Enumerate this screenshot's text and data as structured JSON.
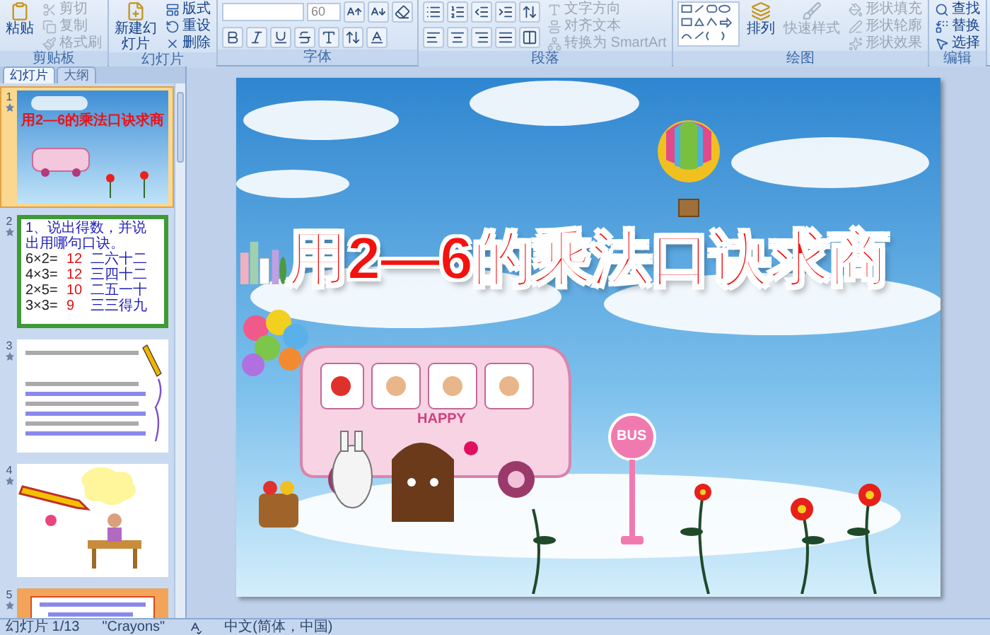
{
  "ribbon": {
    "groups": [
      {
        "kind": "clipboard",
        "label": "剪贴板",
        "large": [
          {
            "label": "粘贴",
            "disabled": false
          }
        ],
        "items": [
          {
            "label": "剪切",
            "disabled": true
          },
          {
            "label": "复制",
            "disabled": true
          },
          {
            "label": "格式刷",
            "disabled": true
          }
        ]
      },
      {
        "kind": "slides",
        "label": "幻灯片",
        "large": [
          {
            "label": "新建幻灯片",
            "disabled": false
          }
        ],
        "items": [
          {
            "label": "版式",
            "disabled": false
          },
          {
            "label": "重设",
            "disabled": false
          },
          {
            "label": "删除",
            "disabled": false
          }
        ]
      },
      {
        "kind": "font",
        "label": "字体",
        "size": "60"
      },
      {
        "kind": "paragraph",
        "label": "段落",
        "items": [
          {
            "label": "文字方向",
            "disabled": true
          },
          {
            "label": "对齐文本",
            "disabled": true
          },
          {
            "label": "转换为 SmartArt",
            "disabled": true
          }
        ]
      },
      {
        "kind": "drawing",
        "label": "绘图",
        "large": [
          {
            "label": "排列",
            "disabled": false
          },
          {
            "label": "快速样式",
            "disabled": true
          }
        ],
        "items": [
          {
            "label": "形状填充",
            "disabled": true
          },
          {
            "label": "形状轮廓",
            "disabled": true
          },
          {
            "label": "形状效果",
            "disabled": true
          }
        ]
      },
      {
        "kind": "editing",
        "label": "编辑",
        "items": [
          {
            "label": "查找",
            "disabled": false
          },
          {
            "label": "替换",
            "disabled": false
          },
          {
            "label": "选择",
            "disabled": false
          }
        ]
      }
    ]
  },
  "panel": {
    "tabs": [
      {
        "label": "幻灯片",
        "selected": true
      },
      {
        "label": "大纲",
        "selected": false
      }
    ],
    "slides": [
      {
        "number": "1",
        "selected": true,
        "kind": "title",
        "title": "用2—6的乘法口诀求商"
      },
      {
        "number": "2",
        "selected": false,
        "kind": "exercise",
        "heading": "1、说出得数，并说出用哪句口诀。",
        "rows": [
          {
            "expr": "6×2=",
            "answer": "12",
            "rhyme": "二六十二"
          },
          {
            "expr": "4×3=",
            "answer": "12",
            "rhyme": "三四十二"
          },
          {
            "expr": "2×5=",
            "answer": "10",
            "rhyme": "二五一十"
          },
          {
            "expr": "3×3=",
            "answer": "9",
            "rhyme": "三三得九"
          }
        ]
      },
      {
        "number": "3",
        "selected": false,
        "kind": "worksheet"
      },
      {
        "number": "4",
        "selected": false,
        "kind": "cartoon"
      },
      {
        "number": "5",
        "selected": false,
        "kind": "story"
      }
    ]
  },
  "slide": {
    "title": "用2—6的乘法口诀求商",
    "bus_text": "HAPPY",
    "sign_text": "BUS"
  },
  "status_bar": [
    "幻灯片 1/13",
    "\"Crayons\"",
    "中文(简体，中国)"
  ]
}
